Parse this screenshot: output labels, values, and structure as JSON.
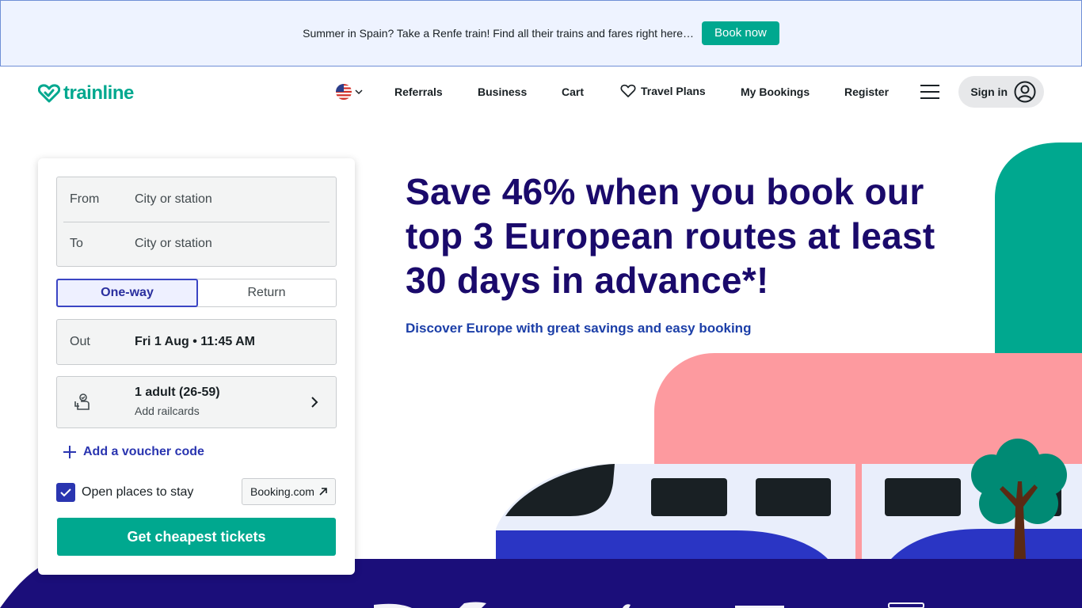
{
  "banner": {
    "text": "Summer in Spain? Take a Renfe train! Find all their trains and fares right here…",
    "button": "Book now"
  },
  "header": {
    "logo": "trainline",
    "nav": {
      "referrals": "Referrals",
      "business": "Business",
      "cart": "Cart",
      "travel_plans": "Travel Plans",
      "my_bookings": "My Bookings",
      "register": "Register"
    },
    "sign_in": "Sign in"
  },
  "search": {
    "from_label": "From",
    "from_placeholder": "City or station",
    "to_label": "To",
    "to_placeholder": "City or station",
    "trip_one_way": "One-way",
    "trip_return": "Return",
    "out_label": "Out",
    "out_value": "Fri 1 Aug • 11:45 AM",
    "passengers": "1 adult (26-59)",
    "railcards": "Add railcards",
    "voucher": "Add a voucher code",
    "stay_label": "Open places to stay",
    "stay_checked": true,
    "booking_link": "Booking.com",
    "cta": "Get cheapest tickets"
  },
  "hero": {
    "title": "Save 46% when you book our top 3 European routes at least 30 days in advance*!",
    "subtitle": "Discover Europe with great savings and easy booking"
  },
  "colors": {
    "brand": "#00a88f",
    "heading": "#1a0a6b",
    "accent_blue": "#2a35b0",
    "navy": "#1b0e7a",
    "pink": "#fd9a9f"
  }
}
